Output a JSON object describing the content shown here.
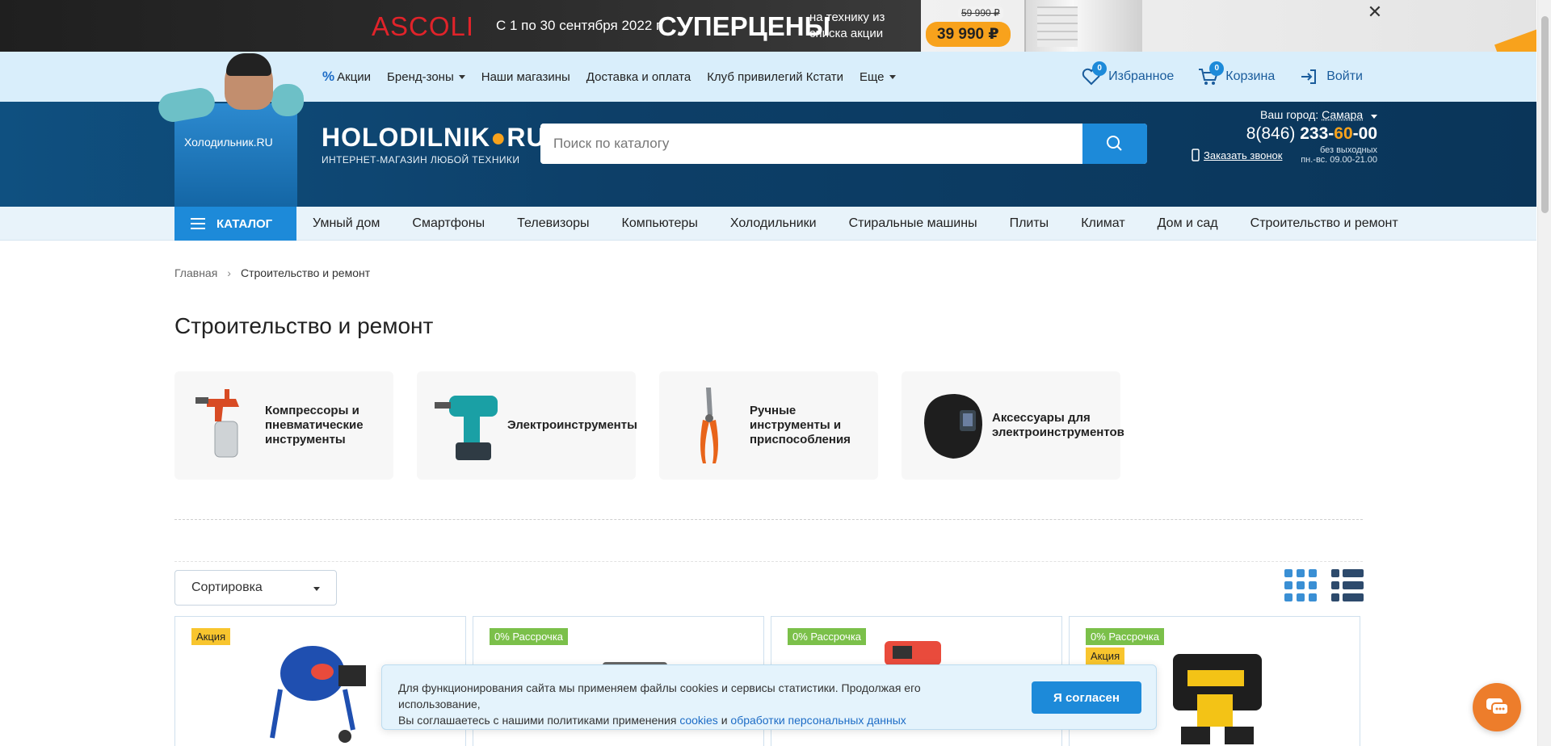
{
  "promo": {
    "brand": "ASCOLI",
    "dates": "С 1 по 30 сентября 2022 г.",
    "headline": "СУПЕРЦЕНЫ",
    "subline": "на технику из списка акции",
    "old_price": "59 990 ₽",
    "price": "39 990 ₽",
    "close": "✕"
  },
  "topnav": {
    "items": [
      {
        "label": "Акции",
        "icon": "percent-icon"
      },
      {
        "label": "Бренд-зоны",
        "dropdown": true
      },
      {
        "label": "Наши магазины"
      },
      {
        "label": "Доставка и оплата"
      },
      {
        "label": "Клуб привилегий Кстати"
      },
      {
        "label": "Еще",
        "dropdown": true
      }
    ],
    "favorites": {
      "label": "Избранное",
      "count": "0"
    },
    "cart": {
      "label": "Корзина",
      "count": "0"
    },
    "login": {
      "label": "Войти"
    }
  },
  "mascot": {
    "fridge_label": "Холодильник.RU"
  },
  "logo": {
    "main_pre": "HOLODILNIK",
    "main_post": "RU",
    "sub": "ИНТЕРНЕТ-МАГАЗИН ЛЮБОЙ ТЕХНИКИ"
  },
  "search": {
    "placeholder": "Поиск по каталогу"
  },
  "contacts": {
    "city_label": "Ваш город:",
    "city": "Самара",
    "phone_prefix": "8(846)",
    "phone_main": "233-",
    "phone_accent": "60",
    "phone_tail": "-00",
    "callback": "Заказать звонок",
    "hours_1": "без выходных",
    "hours_2": "пн.-вс. 09.00-21.00"
  },
  "catnav": {
    "catalog": "КАТАЛОГ",
    "links": [
      "Умный дом",
      "Смартфоны",
      "Телевизоры",
      "Компьютеры",
      "Холодильники",
      "Стиральные машины",
      "Плиты",
      "Климат",
      "Дом и сад",
      "Строительство и ремонт"
    ]
  },
  "breadcrumb": {
    "home": "Главная",
    "current": "Строительство и ремонт"
  },
  "page": {
    "title": "Строительство и ремонт"
  },
  "subcategories": [
    {
      "label": "Компрессоры и пневматические инструменты",
      "icon": "spray-gun-icon"
    },
    {
      "label": "Электроинструменты",
      "icon": "drill-icon"
    },
    {
      "label": "Ручные инструменты и приспособления",
      "icon": "pliers-icon"
    },
    {
      "label": "Аксессуары для электроинструментов",
      "icon": "welding-mask-icon"
    }
  ],
  "sort": {
    "label": "Сортировка"
  },
  "products": [
    {
      "tags": [
        "Акция"
      ],
      "icon": "concrete-mixer-icon"
    },
    {
      "tags": [
        "0% Рассрочка"
      ],
      "icon": "tool-icon"
    },
    {
      "tags": [
        "0% Рассрочка"
      ],
      "icon": "compressor-icon"
    },
    {
      "tags": [
        "0% Рассрочка",
        "Акция"
      ],
      "icon": "cordless-drill-icon"
    }
  ],
  "cookie": {
    "line1": "Для функционирования сайта мы применяем файлы cookies и сервисы статистики. Продолжая его использование,",
    "line2_pre": "Вы соглашаетесь с нашими политиками применения",
    "link_cookies": "cookies",
    "and": "и",
    "link_privacy": "обработки персональных данных",
    "accept": "Я согласен"
  },
  "colors": {
    "accent": "#1d8ad9",
    "brand_orange": "#f8a21c",
    "header_dark": "#0d3f68",
    "sale": "#f8c52e",
    "credit": "#7bc04a"
  }
}
